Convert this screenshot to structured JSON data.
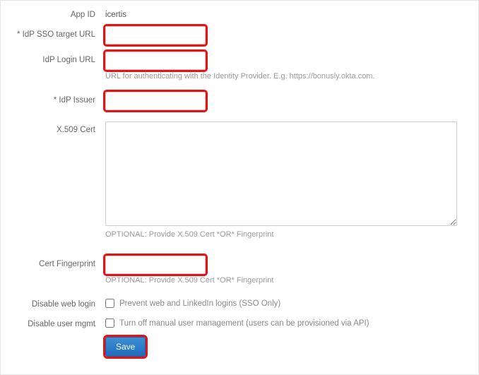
{
  "fields": {
    "app_id": {
      "label": "App ID",
      "value": "icertis"
    },
    "sso_target": {
      "label": "* IdP SSO target URL",
      "value": ""
    },
    "login_url": {
      "label": "IdP Login URL",
      "value": "",
      "help": "URL for authenticating with the Identity Provider. E.g. https://bonusly.okta.com."
    },
    "issuer": {
      "label": "* IdP Issuer",
      "value": ""
    },
    "x509": {
      "label": "X.509 Cert",
      "value": "",
      "help": "OPTIONAL: Provide X.509 Cert *OR* Fingerprint"
    },
    "fingerprint": {
      "label": "Cert Fingerprint",
      "value": "",
      "help": "OPTIONAL: Provide X.509 Cert *OR* Fingerprint"
    },
    "disable_web": {
      "label": "Disable web login",
      "checkbox_label": "Prevent web and LinkedIn logins (SSO Only)"
    },
    "disable_mgmt": {
      "label": "Disable user mgmt",
      "checkbox_label": "Turn off manual user management (users can be provisioned via API)"
    }
  },
  "buttons": {
    "save": "Save"
  }
}
